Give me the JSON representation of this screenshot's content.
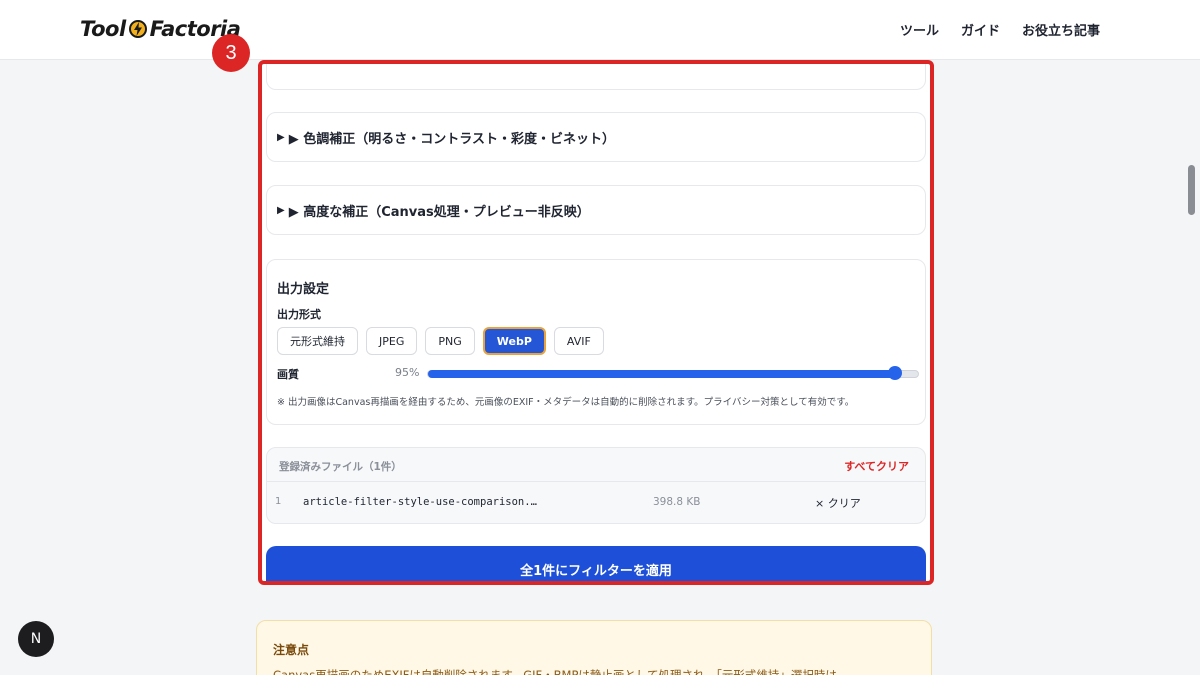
{
  "header": {
    "logo_left": "Tool",
    "logo_right": "Factoria",
    "nav": [
      "ツール",
      "ガイド",
      "お役立ち記事"
    ]
  },
  "badge": "3",
  "accordions": [
    {
      "marker": "▶",
      "label": "▶ 色調補正（明るさ・コントラスト・彩度・ビネット）"
    },
    {
      "marker": "▶",
      "label": "▶ 高度な補正（Canvas処理・プレビュー非反映）"
    }
  ],
  "output": {
    "title": "出力設定",
    "format_label": "出力形式",
    "formats": [
      "元形式維持",
      "JPEG",
      "PNG",
      "WebP",
      "AVIF"
    ],
    "selected_format": "WebP",
    "quality_label": "画質",
    "quality_value": "95%",
    "quality_fraction": 0.95,
    "note": "※ 出力画像はCanvas再描画を経由するため、元画像のEXIF・メタデータは自動的に削除されます。プライバシー対策として有効です。"
  },
  "files": {
    "title": "登録済みファイル（1件）",
    "clear_all": "すべてクリア",
    "rows": [
      {
        "index": "1",
        "name": "article-filter-style-use-comparison.…",
        "size": "398.8 KB",
        "clear": "× クリア"
      }
    ]
  },
  "apply_button": "全1件にフィルターを適用",
  "warning": {
    "title": "注意点",
    "text": "Canvas再描画のためEXIFは自動削除されます。GIF・BMPは静止画として処理され、「元形式維持」選択時は"
  },
  "fab": "N",
  "colors": {
    "accent": "#2456d6",
    "highlight": "#dc2626",
    "selected_border": "#e8a33d"
  }
}
